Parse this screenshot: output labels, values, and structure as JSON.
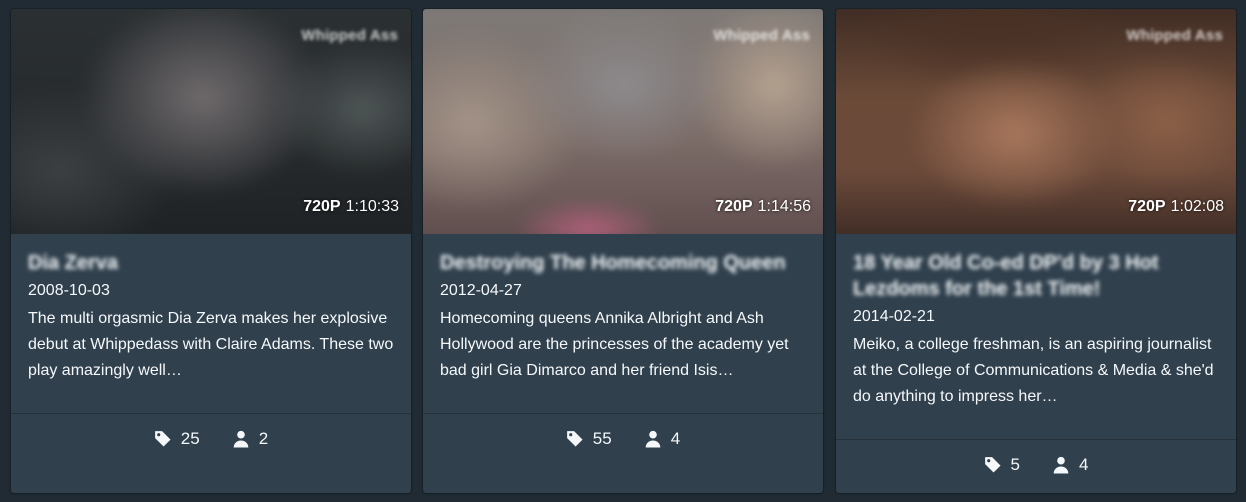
{
  "cards": [
    {
      "watermark": "Whipped Ass",
      "resolution": "720P",
      "duration": "1:10:33",
      "title": "Dia Zerva",
      "date": "2008-10-03",
      "description": "The multi orgasmic Dia Zerva makes her explosive debut at Whippedass with Claire Adams. These two play amazingly well…",
      "tag_count": "25",
      "performer_count": "2"
    },
    {
      "watermark": "Whipped Ass",
      "resolution": "720P",
      "duration": "1:14:56",
      "title": "Destroying The Homecoming Queen",
      "date": "2012-04-27",
      "description": "Homecoming queens Annika Albright and Ash Hollywood are the princesses of the academy yet bad girl Gia Dimarco and her friend Isis…",
      "tag_count": "55",
      "performer_count": "4"
    },
    {
      "watermark": "Whipped Ass",
      "resolution": "720P",
      "duration": "1:02:08",
      "title": "18 Year Old Co-ed DP'd by 3 Hot Lezdoms for the 1st Time!",
      "date": "2014-02-21",
      "description": "Meiko, a college freshman, is an aspiring journalist at the College of Communications & Media & she'd do anything to impress her…",
      "tag_count": "5",
      "performer_count": "4"
    }
  ],
  "icons": {
    "tag": "tag-icon",
    "performer": "user-icon"
  }
}
